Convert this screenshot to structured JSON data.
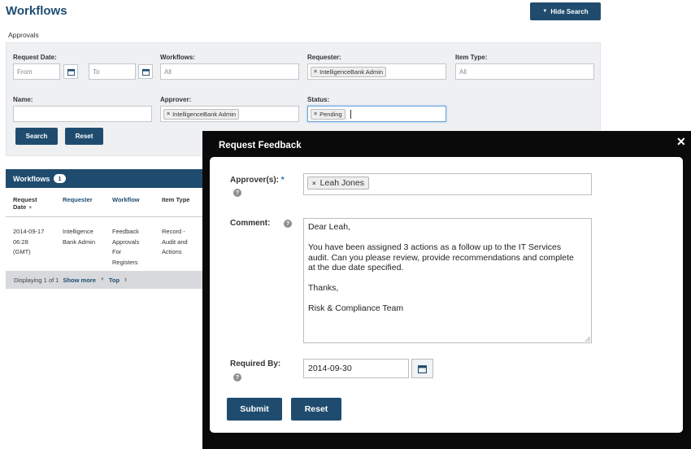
{
  "page": {
    "title": "Workflows",
    "breadcrumb": "Approvals"
  },
  "toolbar": {
    "hide_search_label": "Hide Search"
  },
  "search": {
    "request_date_label": "Request Date:",
    "from_placeholder": "From",
    "to_placeholder": "To",
    "workflows_label": "Workflows:",
    "workflows_value": "All",
    "requester_label": "Requester:",
    "requester_tag": "IntelligenceBank Admin",
    "item_type_label": "Item Type:",
    "item_type_value": "All",
    "name_label": "Name:",
    "approver_label": "Approver:",
    "approver_tag": "IntelligenceBank Admin",
    "status_label": "Status:",
    "status_tag": "Pending",
    "search_button": "Search",
    "reset_button": "Reset"
  },
  "results": {
    "header": "Workflows",
    "count": "1",
    "columns": {
      "request_date_line1": "Request",
      "request_date_line2": "Date",
      "requester": "Requester",
      "workflow": "Workflow",
      "item_type": "Item Type"
    },
    "row": {
      "date": [
        "2014-09-17",
        "06:28",
        "(GMT)"
      ],
      "requester": [
        "Intelligence",
        "Bank Admin"
      ],
      "workflow": [
        "Feedback",
        "Approvals",
        "For",
        "Registers"
      ],
      "item_type": [
        "Record -",
        "Audit and",
        "Actions"
      ]
    },
    "footer": {
      "displaying": "Displaying 1 of 1",
      "show_more": "Show more",
      "top": "Top"
    }
  },
  "modal": {
    "title": "Request Feedback",
    "approvers_label": "Approver(s):",
    "approvers_required": "*",
    "approver_tag": "Leah Jones",
    "comment_label": "Comment:",
    "comment_lines": {
      "greeting": "Dear Leah,",
      "body1": "You have been assigned 3 actions as a follow up to the IT Services",
      "body2": "audit.  Can you please review, provide recommendations and complete",
      "body3": "at the due date specified.",
      "thanks": "Thanks,",
      "signature": "Risk & Compliance Team"
    },
    "required_by_label": "Required By:",
    "required_by_value": "2014-09-30",
    "submit_button": "Submit",
    "reset_button": "Reset"
  },
  "colors": {
    "primary": "#1f4c6e",
    "modal_backdrop": "#0a0a0a",
    "panel_bg": "#eef0f2"
  }
}
